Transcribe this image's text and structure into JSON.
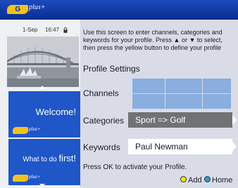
{
  "header": {
    "logo_text": "Guide Plus+",
    "logo_mark": "G",
    "logo_plus": "plus+"
  },
  "clock": {
    "date": "1-Sep",
    "time": "16:47"
  },
  "promos": [
    {
      "text": "Welcome!"
    },
    {
      "text_small": "What to do ",
      "text_big": "first!"
    }
  ],
  "instructions": "Use this screen to enter channels, categories and keywords for your profile.  Press ▲ or ▼ to select, then press the yellow button to define your profile",
  "profile": {
    "title": "Profile Settings",
    "channels_label": "Channels",
    "categories_label": "Categories",
    "categories_value": "Sport => Golf",
    "keywords_label": "Keywords",
    "keywords_value": "Paul Newman",
    "channel_cells": [
      "",
      "",
      "",
      "",
      "",
      ""
    ]
  },
  "footer": {
    "hint": "Press OK to activate your Profile.",
    "add_label": "Add",
    "home_label": "Home"
  },
  "colors": {
    "topbar": "#0a2c8e",
    "logo_yellow": "#f0c21e",
    "promo_blue": "#1f56c8",
    "channel_cell": "#8aaedf",
    "categories_field": "#707276",
    "add_button": "#f5e000",
    "home_button": "#2a9ae8"
  },
  "icons": {
    "lock": "lock-icon",
    "up": "up-arrow-icon",
    "down": "down-arrow-icon",
    "right": "chevron-right-icon"
  }
}
